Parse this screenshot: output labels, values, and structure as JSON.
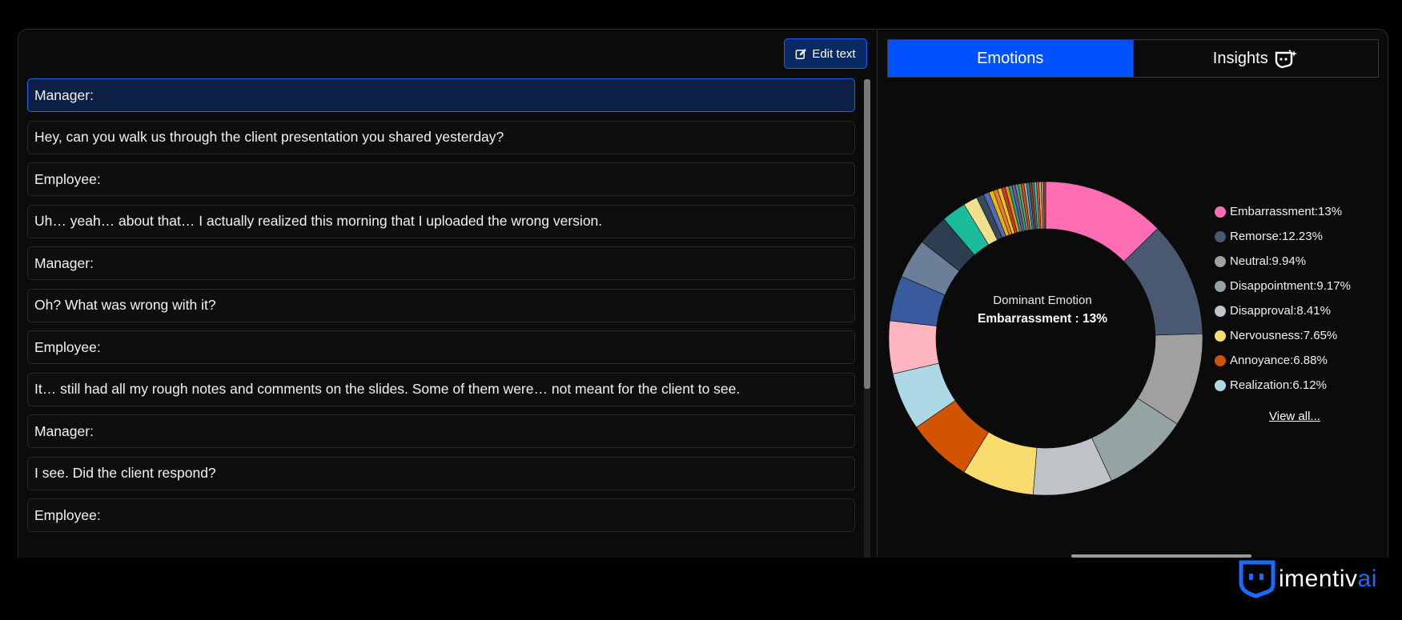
{
  "toolbar": {
    "edit_label": "Edit text"
  },
  "transcript": [
    "Manager:",
    "Hey, can you walk us through the client presentation you shared yesterday?",
    "Employee:",
    "Uh… yeah… about that… I actually realized this morning that I uploaded the wrong version.",
    "Manager:",
    "Oh? What was wrong with it?",
    "Employee:",
    "It… still had all my rough notes and comments on the slides. Some of them were… not meant for the client to see.",
    "Manager:",
    "I see. Did the client respond?",
    "Employee:"
  ],
  "tabs": [
    {
      "label": "Emotions",
      "active": true
    },
    {
      "label": "Insights",
      "active": false,
      "icon": "sparkle-face-icon"
    }
  ],
  "chart": {
    "center_label": "Dominant Emotion",
    "center_value": "Embarrassment : 13%",
    "view_all": "View all..."
  },
  "chart_data": {
    "type": "pie",
    "donut": true,
    "legend_position": "right",
    "slices": [
      {
        "name": "Embarrassment",
        "value": 13,
        "color": "#ff6eb4"
      },
      {
        "name": "Remorse",
        "value": 12.23,
        "color": "#4a5872"
      },
      {
        "name": "Neutral",
        "value": 9.94,
        "color": "#a0a0a0"
      },
      {
        "name": "Disappointment",
        "value": 9.17,
        "color": "#95a3a4"
      },
      {
        "name": "Disapproval",
        "value": 8.41,
        "color": "#bfc3c7"
      },
      {
        "name": "Nervousness",
        "value": 7.65,
        "color": "#f8dc6e"
      },
      {
        "name": "Annoyance",
        "value": 6.88,
        "color": "#d35400"
      },
      {
        "name": "Realization",
        "value": 6.12,
        "color": "#add8e6"
      },
      {
        "value": 5.6,
        "color": "#ffb6c1"
      },
      {
        "value": 4.8,
        "color": "#3a5a9e"
      },
      {
        "value": 4.2,
        "color": "#6b7f99"
      },
      {
        "value": 3.3,
        "color": "#2c3e50"
      },
      {
        "value": 2.6,
        "color": "#1abc9c"
      },
      {
        "value": 1.5,
        "color": "#f1e08b"
      },
      {
        "value": 0.8,
        "color": "#34495e"
      },
      {
        "value": 0.6,
        "color": "#5468b8"
      },
      {
        "value": 0.5,
        "color": "#e6b800"
      },
      {
        "value": 0.45,
        "color": "#e67e22"
      },
      {
        "value": 0.42,
        "color": "#f1c40f"
      },
      {
        "value": 0.4,
        "color": "#c0392b"
      },
      {
        "value": 0.38,
        "color": "#e08e0b"
      },
      {
        "value": 0.36,
        "color": "#16a085"
      },
      {
        "value": 0.34,
        "color": "#8e44ad"
      },
      {
        "value": 0.32,
        "color": "#27ae60"
      },
      {
        "value": 0.3,
        "color": "#7f8c8d"
      },
      {
        "value": 0.3,
        "color": "#d35400"
      },
      {
        "value": 0.28,
        "color": "#95a5a6"
      },
      {
        "value": 0.28,
        "color": "#2980b9"
      },
      {
        "value": 0.26,
        "color": "#a04000"
      },
      {
        "value": 0.26,
        "color": "#5d6d7e"
      },
      {
        "value": 0.25,
        "color": "#48c9b0"
      },
      {
        "value": 0.25,
        "color": "#e74c3c"
      },
      {
        "value": 0.24,
        "color": "#f5b041"
      },
      {
        "value": 0.24,
        "color": "#85929e"
      },
      {
        "value": 0.23,
        "color": "#b03a2e"
      }
    ]
  },
  "logo": {
    "main": "imentiv",
    "suffix": "ai"
  }
}
